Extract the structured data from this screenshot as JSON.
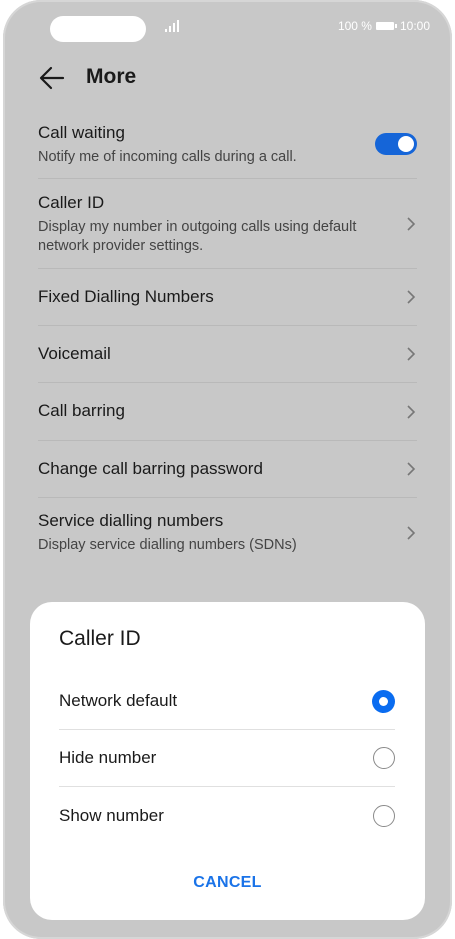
{
  "status_bar": {
    "battery_text": "100 %",
    "time": "10:00"
  },
  "header": {
    "title": "More",
    "back_icon": "arrow-left-icon"
  },
  "settings": {
    "items": [
      {
        "title": "Call waiting",
        "subtitle": "Notify me of incoming calls during a call.",
        "control": "toggle",
        "toggle_on": true
      },
      {
        "title": "Caller ID",
        "subtitle": "Display my number in outgoing calls using default network provider settings.",
        "control": "chevron"
      },
      {
        "title": "Fixed Dialling Numbers",
        "control": "chevron"
      },
      {
        "title": "Voicemail",
        "control": "chevron"
      },
      {
        "title": "Call barring",
        "control": "chevron"
      },
      {
        "title": "Change call barring password",
        "control": "chevron"
      },
      {
        "title": "Service dialling numbers",
        "subtitle": "Display service dialling numbers (SDNs)",
        "control": "chevron"
      }
    ]
  },
  "dialog": {
    "title": "Caller ID",
    "options": [
      {
        "label": "Network default",
        "selected": true
      },
      {
        "label": "Hide number",
        "selected": false
      },
      {
        "label": "Show number",
        "selected": false
      }
    ],
    "cancel_label": "CANCEL"
  },
  "colors": {
    "accent": "#0a6cf0",
    "toggle": "#1565d8",
    "dim_background": "#c8c8c8",
    "cancel_text": "#1a73e8"
  }
}
